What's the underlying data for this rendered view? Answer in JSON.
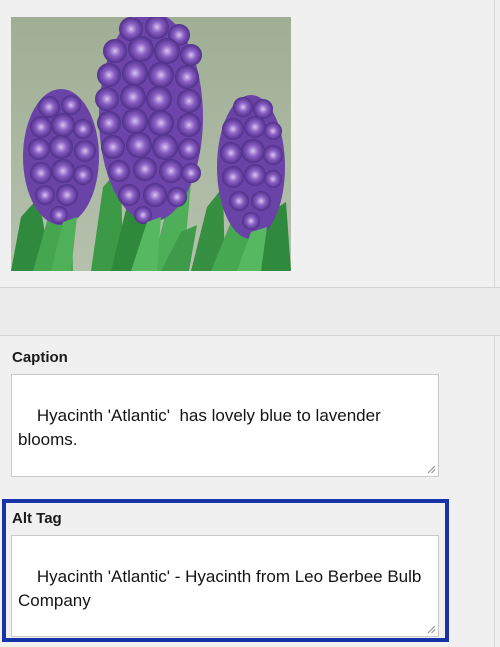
{
  "media": {
    "image_subject": "purple hyacinth flowers photo"
  },
  "caption": {
    "label": "Caption",
    "value": "Hyacinth 'Atlantic'  has lovely blue to lavender blooms."
  },
  "alt_tag": {
    "label": "Alt Tag",
    "value": "Hyacinth 'Atlantic' - Hyacinth from Leo Berbee Bulb Company"
  },
  "colors": {
    "highlight": "#1733a8",
    "flower": "#7a4fb5",
    "leaf": "#3f9a4a"
  }
}
